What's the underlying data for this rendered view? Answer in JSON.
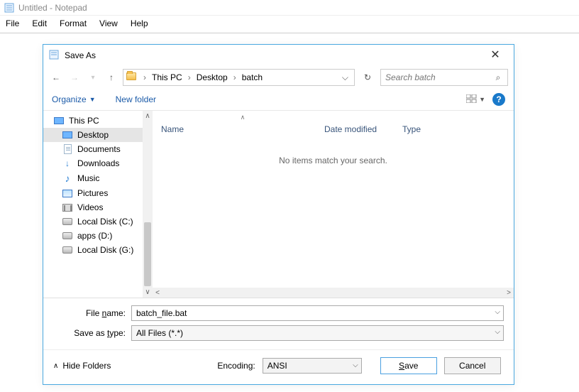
{
  "notepad": {
    "title": "Untitled - Notepad",
    "menus": [
      "File",
      "Edit",
      "Format",
      "View",
      "Help"
    ]
  },
  "dialog": {
    "title": "Save As",
    "breadcrumb": [
      "This PC",
      "Desktop",
      "batch"
    ],
    "search_placeholder": "Search batch",
    "organize_label": "Organize",
    "newfolder_label": "New folder",
    "help_label": "?",
    "columns": {
      "name": "Name",
      "date": "Date modified",
      "type": "Type"
    },
    "empty_message": "No items match your search.",
    "tree": [
      {
        "label": "This PC",
        "icon": "monitor"
      },
      {
        "label": "Desktop",
        "icon": "monitor",
        "selected": true
      },
      {
        "label": "Documents",
        "icon": "doc"
      },
      {
        "label": "Downloads",
        "icon": "down"
      },
      {
        "label": "Music",
        "icon": "music"
      },
      {
        "label": "Pictures",
        "icon": "pic"
      },
      {
        "label": "Videos",
        "icon": "vid"
      },
      {
        "label": "Local Disk (C:)",
        "icon": "disk"
      },
      {
        "label": "apps (D:)",
        "icon": "disk"
      },
      {
        "label": "Local Disk (G:)",
        "icon": "disk"
      }
    ],
    "filename_label": "File name:",
    "filename_value": "batch_file.bat",
    "savetype_label": "Save as type:",
    "savetype_value": "All Files  (*.*)",
    "hide_folders_label": "Hide Folders",
    "encoding_label": "Encoding:",
    "encoding_value": "ANSI",
    "save_label": "Save",
    "cancel_label": "Cancel"
  }
}
